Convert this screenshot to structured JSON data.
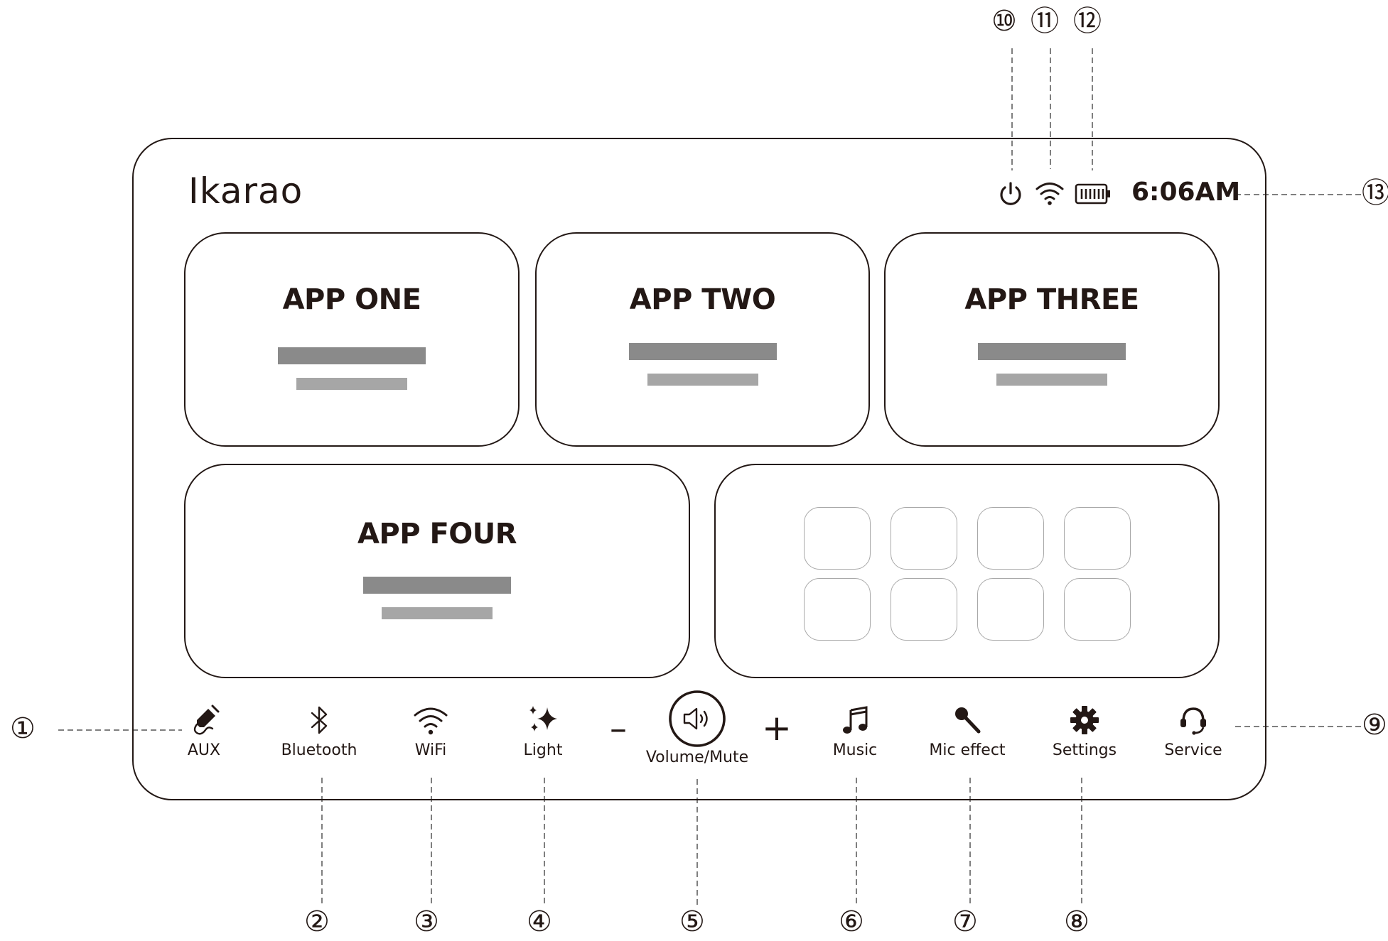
{
  "header": {
    "brand": "Ikarao",
    "time": "6:06AM",
    "status_icons": [
      "power-icon",
      "wifi-icon",
      "battery-icon"
    ]
  },
  "apps": [
    {
      "title": "APP ONE"
    },
    {
      "title": "APP TWO"
    },
    {
      "title": "APP THREE"
    },
    {
      "title": "APP FOUR"
    }
  ],
  "grid_tiles": 8,
  "toolbar": {
    "aux": "AUX",
    "bluetooth": "Bluetooth",
    "wifi": "WiFi",
    "light": "Light",
    "minus": "–",
    "volume": "Volume/Mute",
    "plus": "+",
    "music": "Music",
    "mic": "Mic effect",
    "settings": "Settings",
    "service": "Service"
  },
  "callouts": {
    "c1": "①",
    "c2": "②",
    "c3": "③",
    "c4": "④",
    "c5": "⑤",
    "c6": "⑥",
    "c7": "⑦",
    "c8": "⑧",
    "c9": "⑨",
    "c10": "⑩",
    "c11": "⑪",
    "c12": "⑫",
    "c13": "⑬"
  },
  "colors": {
    "ink": "#231815",
    "bar_dark": "#8a8a8a",
    "bar_light": "#a6a6a6",
    "tile_border": "#a8a8a8"
  }
}
